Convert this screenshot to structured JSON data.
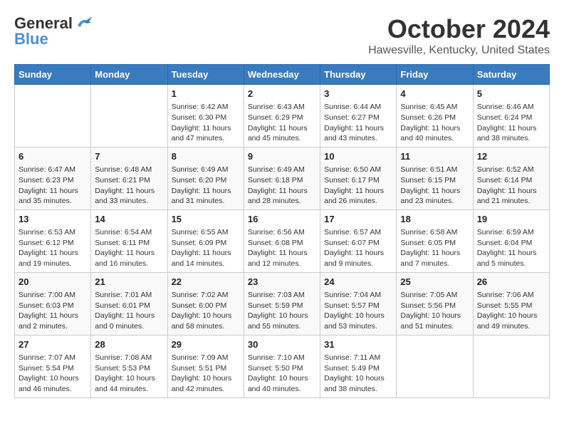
{
  "header": {
    "logo_general": "General",
    "logo_blue": "Blue",
    "title": "October 2024",
    "subtitle": "Hawesville, Kentucky, United States"
  },
  "weekdays": [
    "Sunday",
    "Monday",
    "Tuesday",
    "Wednesday",
    "Thursday",
    "Friday",
    "Saturday"
  ],
  "weeks": [
    [
      {
        "day": "",
        "content": ""
      },
      {
        "day": "",
        "content": ""
      },
      {
        "day": "1",
        "content": "Sunrise: 6:42 AM\nSunset: 6:30 PM\nDaylight: 11 hours and 47 minutes."
      },
      {
        "day": "2",
        "content": "Sunrise: 6:43 AM\nSunset: 6:29 PM\nDaylight: 11 hours and 45 minutes."
      },
      {
        "day": "3",
        "content": "Sunrise: 6:44 AM\nSunset: 6:27 PM\nDaylight: 11 hours and 43 minutes."
      },
      {
        "day": "4",
        "content": "Sunrise: 6:45 AM\nSunset: 6:26 PM\nDaylight: 11 hours and 40 minutes."
      },
      {
        "day": "5",
        "content": "Sunrise: 6:46 AM\nSunset: 6:24 PM\nDaylight: 11 hours and 38 minutes."
      }
    ],
    [
      {
        "day": "6",
        "content": "Sunrise: 6:47 AM\nSunset: 6:23 PM\nDaylight: 11 hours and 35 minutes."
      },
      {
        "day": "7",
        "content": "Sunrise: 6:48 AM\nSunset: 6:21 PM\nDaylight: 11 hours and 33 minutes."
      },
      {
        "day": "8",
        "content": "Sunrise: 6:49 AM\nSunset: 6:20 PM\nDaylight: 11 hours and 31 minutes."
      },
      {
        "day": "9",
        "content": "Sunrise: 6:49 AM\nSunset: 6:18 PM\nDaylight: 11 hours and 28 minutes."
      },
      {
        "day": "10",
        "content": "Sunrise: 6:50 AM\nSunset: 6:17 PM\nDaylight: 11 hours and 26 minutes."
      },
      {
        "day": "11",
        "content": "Sunrise: 6:51 AM\nSunset: 6:15 PM\nDaylight: 11 hours and 23 minutes."
      },
      {
        "day": "12",
        "content": "Sunrise: 6:52 AM\nSunset: 6:14 PM\nDaylight: 11 hours and 21 minutes."
      }
    ],
    [
      {
        "day": "13",
        "content": "Sunrise: 6:53 AM\nSunset: 6:12 PM\nDaylight: 11 hours and 19 minutes."
      },
      {
        "day": "14",
        "content": "Sunrise: 6:54 AM\nSunset: 6:11 PM\nDaylight: 11 hours and 16 minutes."
      },
      {
        "day": "15",
        "content": "Sunrise: 6:55 AM\nSunset: 6:09 PM\nDaylight: 11 hours and 14 minutes."
      },
      {
        "day": "16",
        "content": "Sunrise: 6:56 AM\nSunset: 6:08 PM\nDaylight: 11 hours and 12 minutes."
      },
      {
        "day": "17",
        "content": "Sunrise: 6:57 AM\nSunset: 6:07 PM\nDaylight: 11 hours and 9 minutes."
      },
      {
        "day": "18",
        "content": "Sunrise: 6:58 AM\nSunset: 6:05 PM\nDaylight: 11 hours and 7 minutes."
      },
      {
        "day": "19",
        "content": "Sunrise: 6:59 AM\nSunset: 6:04 PM\nDaylight: 11 hours and 5 minutes."
      }
    ],
    [
      {
        "day": "20",
        "content": "Sunrise: 7:00 AM\nSunset: 6:03 PM\nDaylight: 11 hours and 2 minutes."
      },
      {
        "day": "21",
        "content": "Sunrise: 7:01 AM\nSunset: 6:01 PM\nDaylight: 11 hours and 0 minutes."
      },
      {
        "day": "22",
        "content": "Sunrise: 7:02 AM\nSunset: 6:00 PM\nDaylight: 10 hours and 58 minutes."
      },
      {
        "day": "23",
        "content": "Sunrise: 7:03 AM\nSunset: 5:59 PM\nDaylight: 10 hours and 55 minutes."
      },
      {
        "day": "24",
        "content": "Sunrise: 7:04 AM\nSunset: 5:57 PM\nDaylight: 10 hours and 53 minutes."
      },
      {
        "day": "25",
        "content": "Sunrise: 7:05 AM\nSunset: 5:56 PM\nDaylight: 10 hours and 51 minutes."
      },
      {
        "day": "26",
        "content": "Sunrise: 7:06 AM\nSunset: 5:55 PM\nDaylight: 10 hours and 49 minutes."
      }
    ],
    [
      {
        "day": "27",
        "content": "Sunrise: 7:07 AM\nSunset: 5:54 PM\nDaylight: 10 hours and 46 minutes."
      },
      {
        "day": "28",
        "content": "Sunrise: 7:08 AM\nSunset: 5:53 PM\nDaylight: 10 hours and 44 minutes."
      },
      {
        "day": "29",
        "content": "Sunrise: 7:09 AM\nSunset: 5:51 PM\nDaylight: 10 hours and 42 minutes."
      },
      {
        "day": "30",
        "content": "Sunrise: 7:10 AM\nSunset: 5:50 PM\nDaylight: 10 hours and 40 minutes."
      },
      {
        "day": "31",
        "content": "Sunrise: 7:11 AM\nSunset: 5:49 PM\nDaylight: 10 hours and 38 minutes."
      },
      {
        "day": "",
        "content": ""
      },
      {
        "day": "",
        "content": ""
      }
    ]
  ]
}
